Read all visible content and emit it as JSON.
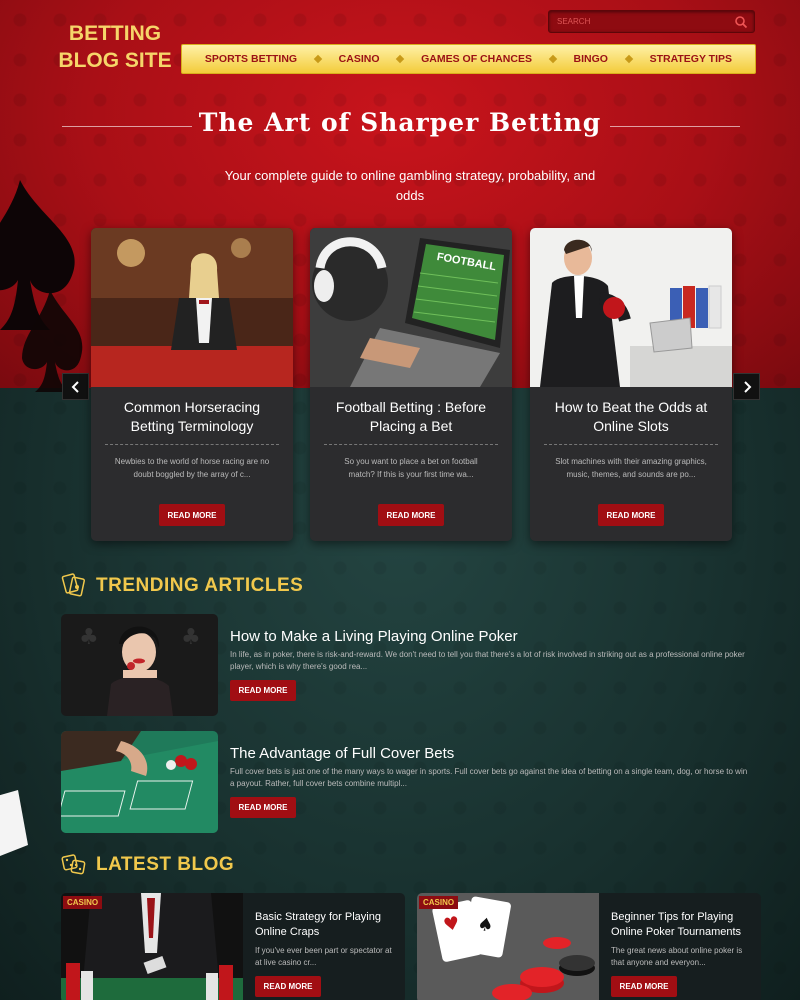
{
  "site": {
    "logo": "BETTING BLOG SITE"
  },
  "search": {
    "placeholder": "SEARCH"
  },
  "nav": {
    "items": [
      "SPORTS BETTING",
      "CASINO",
      "GAMES OF CHANCES",
      "BINGO",
      "STRATEGY TIPS"
    ]
  },
  "hero": {
    "title": "The Art of Sharper Betting",
    "subtitle": "Your complete guide to online gambling strategy, probability, and odds"
  },
  "carousel": [
    {
      "title": "Common Horseracing Betting Terminology",
      "excerpt": "Newbies to the world of horse racing are no doubt boggled by the array of c...",
      "button": "READ MORE"
    },
    {
      "title": "Football Betting : Before Placing a Bet",
      "excerpt": "So you want to place a bet on football match? If this is your first time wa...",
      "button": "READ MORE"
    },
    {
      "title": "How to Beat the Odds at Online Slots",
      "excerpt": "Slot machines with their amazing graphics, music, themes, and sounds are po...",
      "button": "READ MORE"
    }
  ],
  "football_sign": "FOOTBALL",
  "trending": {
    "heading": "TRENDING ARTICLES",
    "items": [
      {
        "title": "How to Make a Living Playing Online Poker",
        "excerpt": "In life, as in poker, there is risk-and-reward. We don't need to tell you that there's a lot of risk involved in striking out as a professional online poker player, which is why there's good rea...",
        "button": "READ MORE"
      },
      {
        "title": "The Advantage of Full Cover Bets",
        "excerpt": "Full cover bets is just one of the many ways to wager in sports. Full cover bets go against the idea of betting on a single team, dog, or horse to win a payout. Rather, full cover bets combine multipl...",
        "button": "READ MORE"
      }
    ]
  },
  "latest": {
    "heading": "LATEST BLOG",
    "items": [
      {
        "tag": "CASINO",
        "title": "Basic Strategy for Playing Online Craps",
        "excerpt": "If you've ever been part or spectator at at live casino cr...",
        "button": "READ MORE"
      },
      {
        "tag": "CASINO",
        "title": "Beginner Tips for Playing Online Poker Tournaments",
        "excerpt": "The great news about online poker is that anyone and everyon...",
        "button": "READ MORE"
      }
    ]
  },
  "colors": {
    "red": "#a90f16",
    "gold": "#f1c84c",
    "green_bg": "#1a2a29",
    "button": "#a10e13"
  }
}
